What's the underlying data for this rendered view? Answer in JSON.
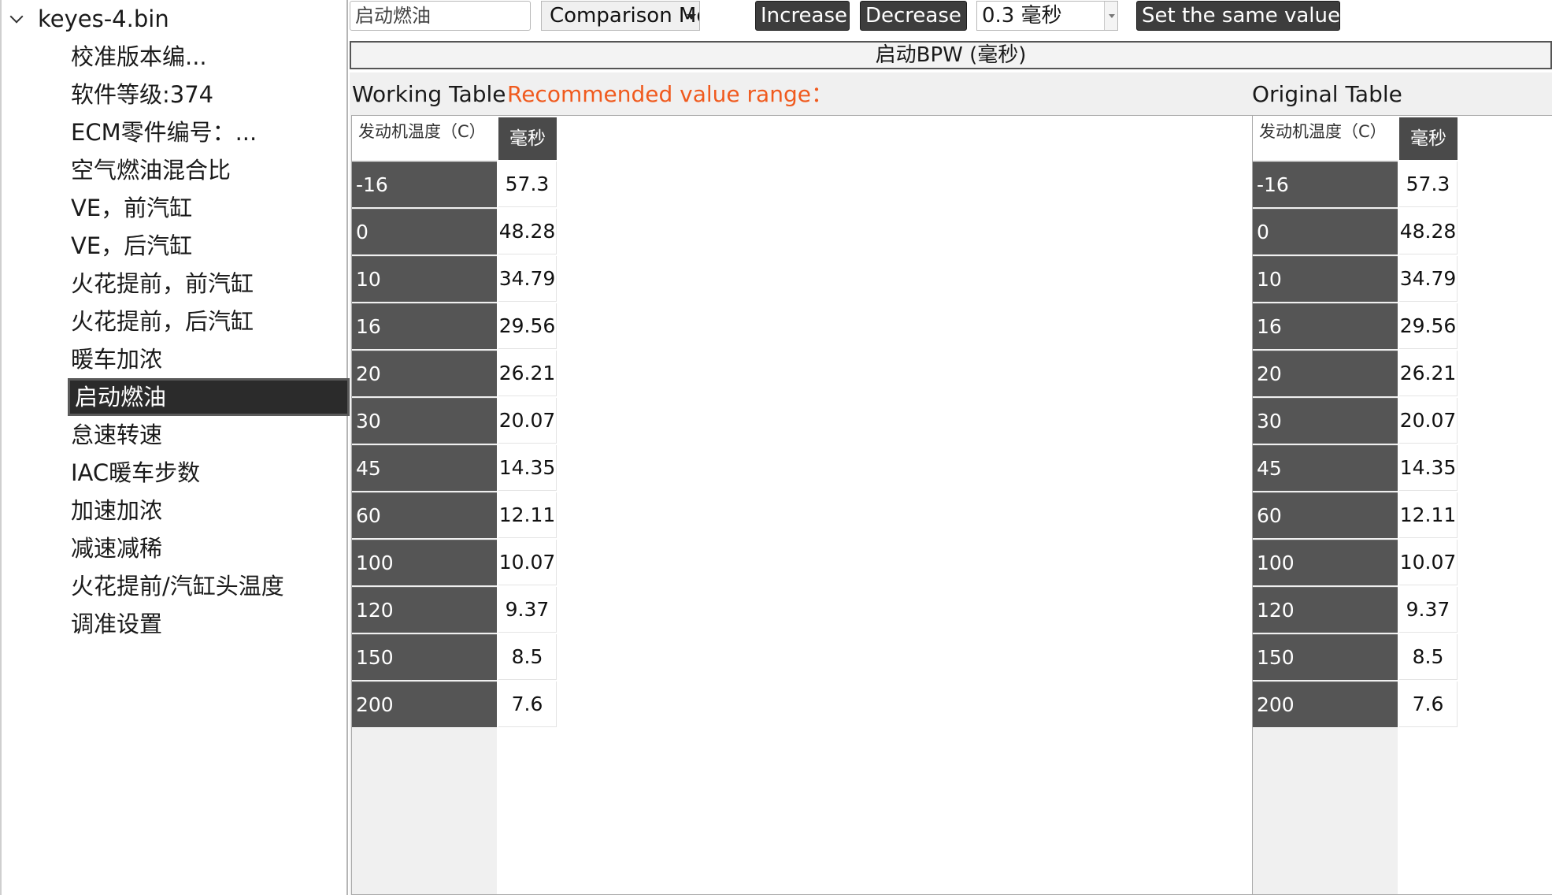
{
  "tree": {
    "root_label": "keyes-4.bin",
    "items": [
      {
        "label": "校准版本编..."
      },
      {
        "label": "软件等级:374"
      },
      {
        "label": "ECM零件编号：..."
      },
      {
        "label": "空气燃油混合比"
      },
      {
        "label": "VE，前汽缸"
      },
      {
        "label": "VE，后汽缸"
      },
      {
        "label": "火花提前，前汽缸"
      },
      {
        "label": "火花提前，后汽缸"
      },
      {
        "label": "暖车加浓"
      },
      {
        "label": "启动燃油",
        "selected": true
      },
      {
        "label": "怠速转速"
      },
      {
        "label": "IAC暖车步数"
      },
      {
        "label": "加速加浓"
      },
      {
        "label": "减速减稀"
      },
      {
        "label": "火花提前/汽缸头温度"
      },
      {
        "label": "调准设置"
      }
    ]
  },
  "toolbar": {
    "search_value": "启动燃油",
    "mode_label": "Comparison Mode",
    "increase_label": "Increase",
    "decrease_label": "Decrease",
    "step_value": "0.3 毫秒",
    "same_value_label": "Set the same value"
  },
  "map_title": "启动BPW (毫秒)",
  "working": {
    "heading": "Working Table",
    "range_label": "Recommended value range："
  },
  "original": {
    "heading": "Original Table"
  },
  "table": {
    "axis_header": "发动机温度（C）",
    "unit_header": "毫秒",
    "rows": [
      {
        "temp": "-16",
        "ms": "57.3"
      },
      {
        "temp": "0",
        "ms": "48.28"
      },
      {
        "temp": "10",
        "ms": "34.79"
      },
      {
        "temp": "16",
        "ms": "29.56"
      },
      {
        "temp": "20",
        "ms": "26.21"
      },
      {
        "temp": "30",
        "ms": "20.07"
      },
      {
        "temp": "45",
        "ms": "14.35"
      },
      {
        "temp": "60",
        "ms": "12.11"
      },
      {
        "temp": "100",
        "ms": "10.07"
      },
      {
        "temp": "120",
        "ms": "9.37"
      },
      {
        "temp": "150",
        "ms": "8.5"
      },
      {
        "temp": "200",
        "ms": "7.6"
      }
    ]
  },
  "colors": {
    "accent_range": "#f05a1e",
    "dark_button": "#3d3d3d",
    "axis_cell": "#555555"
  }
}
